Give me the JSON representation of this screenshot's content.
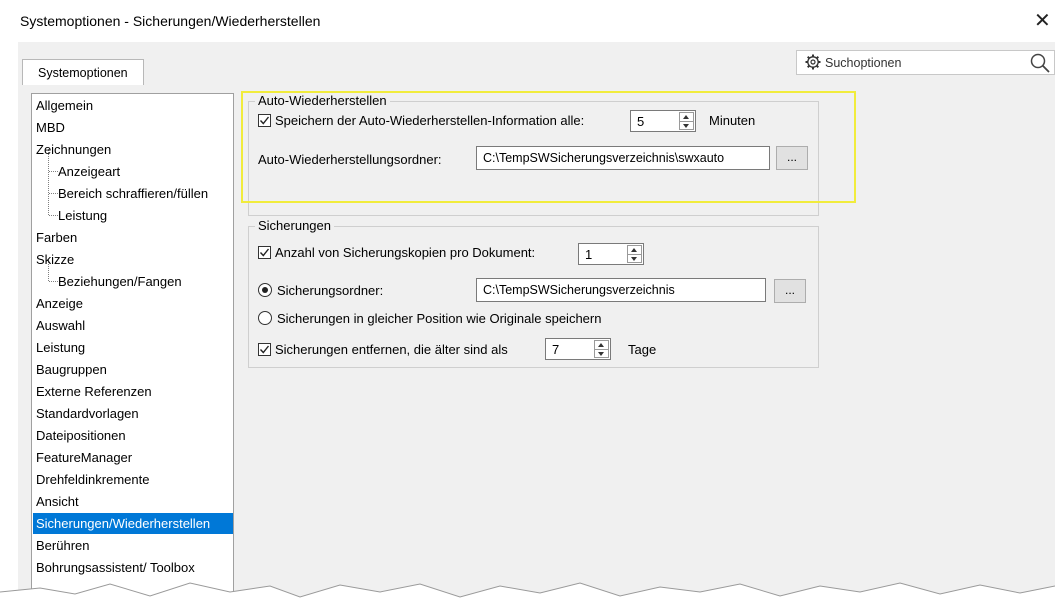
{
  "window": {
    "title": "Systemoptionen - Sicherungen/Wiederherstellen",
    "close_glyph": "✕"
  },
  "tabs": [
    {
      "label": "Systemoptionen"
    }
  ],
  "search": {
    "placeholder": "Suchoptionen"
  },
  "sidebar": {
    "items": [
      {
        "label": "Allgemein",
        "level": 0
      },
      {
        "label": "MBD",
        "level": 0
      },
      {
        "label": "Zeichnungen",
        "level": 0
      },
      {
        "label": "Anzeigeart",
        "level": 1
      },
      {
        "label": "Bereich schraffieren/füllen",
        "level": 1
      },
      {
        "label": "Leistung",
        "level": 1
      },
      {
        "label": "Farben",
        "level": 0
      },
      {
        "label": "Skizze",
        "level": 0
      },
      {
        "label": "Beziehungen/Fangen",
        "level": 1
      },
      {
        "label": "Anzeige",
        "level": 0
      },
      {
        "label": "Auswahl",
        "level": 0
      },
      {
        "label": "Leistung",
        "level": 0
      },
      {
        "label": "Baugruppen",
        "level": 0
      },
      {
        "label": "Externe Referenzen",
        "level": 0
      },
      {
        "label": "Standardvorlagen",
        "level": 0
      },
      {
        "label": "Dateipositionen",
        "level": 0
      },
      {
        "label": "FeatureManager",
        "level": 0
      },
      {
        "label": "Drehfeldinkremente",
        "level": 0
      },
      {
        "label": "Ansicht",
        "level": 0
      },
      {
        "label": "Sicherungen/Wiederherstellen",
        "level": 0,
        "selected": true
      },
      {
        "label": "Berühren",
        "level": 0
      },
      {
        "label": "Bohrungsassistent/ Toolbox",
        "level": 0
      }
    ],
    "selected_color": "#0078d7"
  },
  "auto_recover": {
    "title": "Auto-Wiederherstellen",
    "save_info_label": "Speichern der Auto-Wiederherstellen-Information alle:",
    "save_info_checked": true,
    "interval_value": "5",
    "interval_unit": "Minuten",
    "folder_label": "Auto-Wiederherstellungsordner:",
    "folder_value": "C:\\TempSWSicherungsverzeichnis\\swxauto",
    "browse_label": "..."
  },
  "backups": {
    "title": "Sicherungen",
    "copies_label": "Anzahl von Sicherungskopien pro Dokument:",
    "copies_checked": true,
    "copies_value": "1",
    "backup_folder_label": "Sicherungsordner:",
    "backup_folder_selected": true,
    "backup_folder_value": "C:\\TempSWSicherungsverzeichnis",
    "browse_label": "...",
    "same_location_label": "Sicherungen in gleicher Position wie Originale speichern",
    "same_location_selected": false,
    "remove_label": "Sicherungen entfernen, die älter sind als",
    "remove_checked": true,
    "remove_value": "7",
    "remove_unit": "Tage"
  },
  "colors": {
    "highlight": "#f1ec3c",
    "panel_bg": "#f0f0f0"
  }
}
